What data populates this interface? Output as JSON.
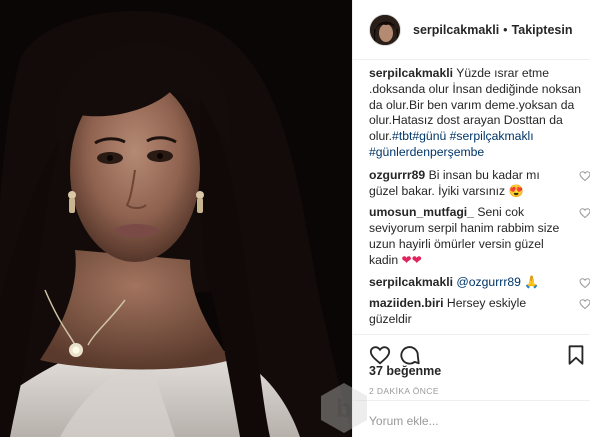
{
  "post": {
    "username": "serpilcakmakli",
    "separator": "•",
    "follow_status": "Takiptesin"
  },
  "caption": {
    "user": "serpilcakmakli",
    "text": "Yüzde ısrar etme .doksanda olur İnsan dediğinde noksan da olur.Bir ben varım deme.yoksan da olur.Hatasız dost arayan Dosttan da olur.",
    "hashtags": "#tbt#günü #serpilçakmaklı #günlerdenperşembe"
  },
  "comments": [
    {
      "user": "ozgurrr89",
      "text": "Bi insan bu kadar mı güzel bakar. İyiki varsınız",
      "emoji": "😍"
    },
    {
      "user": "umosun_mutfagi_",
      "text": "Seni cok seviyorum serpil hanim rabbim size uzun hayirli ömürler versin güzel kadin",
      "emoji": "❤❤"
    },
    {
      "user": "serpilcakmakli",
      "mention": "@ozgurrr89",
      "emoji": "🙏"
    },
    {
      "user": "maziiden.biri",
      "text": "Hersey eskiyle güzeldir"
    }
  ],
  "likes_text": "37 beğenme",
  "timestamp": "2 DAKİKA ÖNCE",
  "comment_input": {
    "placeholder": "Yorum ekle..."
  },
  "icons": {
    "like": "heart-icon",
    "comment": "comment-bubble-icon",
    "save": "bookmark-icon",
    "comment_like": "small-heart-icon"
  },
  "colors": {
    "text": "#262626",
    "hashtag": "#003569",
    "muted": "#999999",
    "border": "#efefef",
    "emoji_red": "#e0245e"
  }
}
